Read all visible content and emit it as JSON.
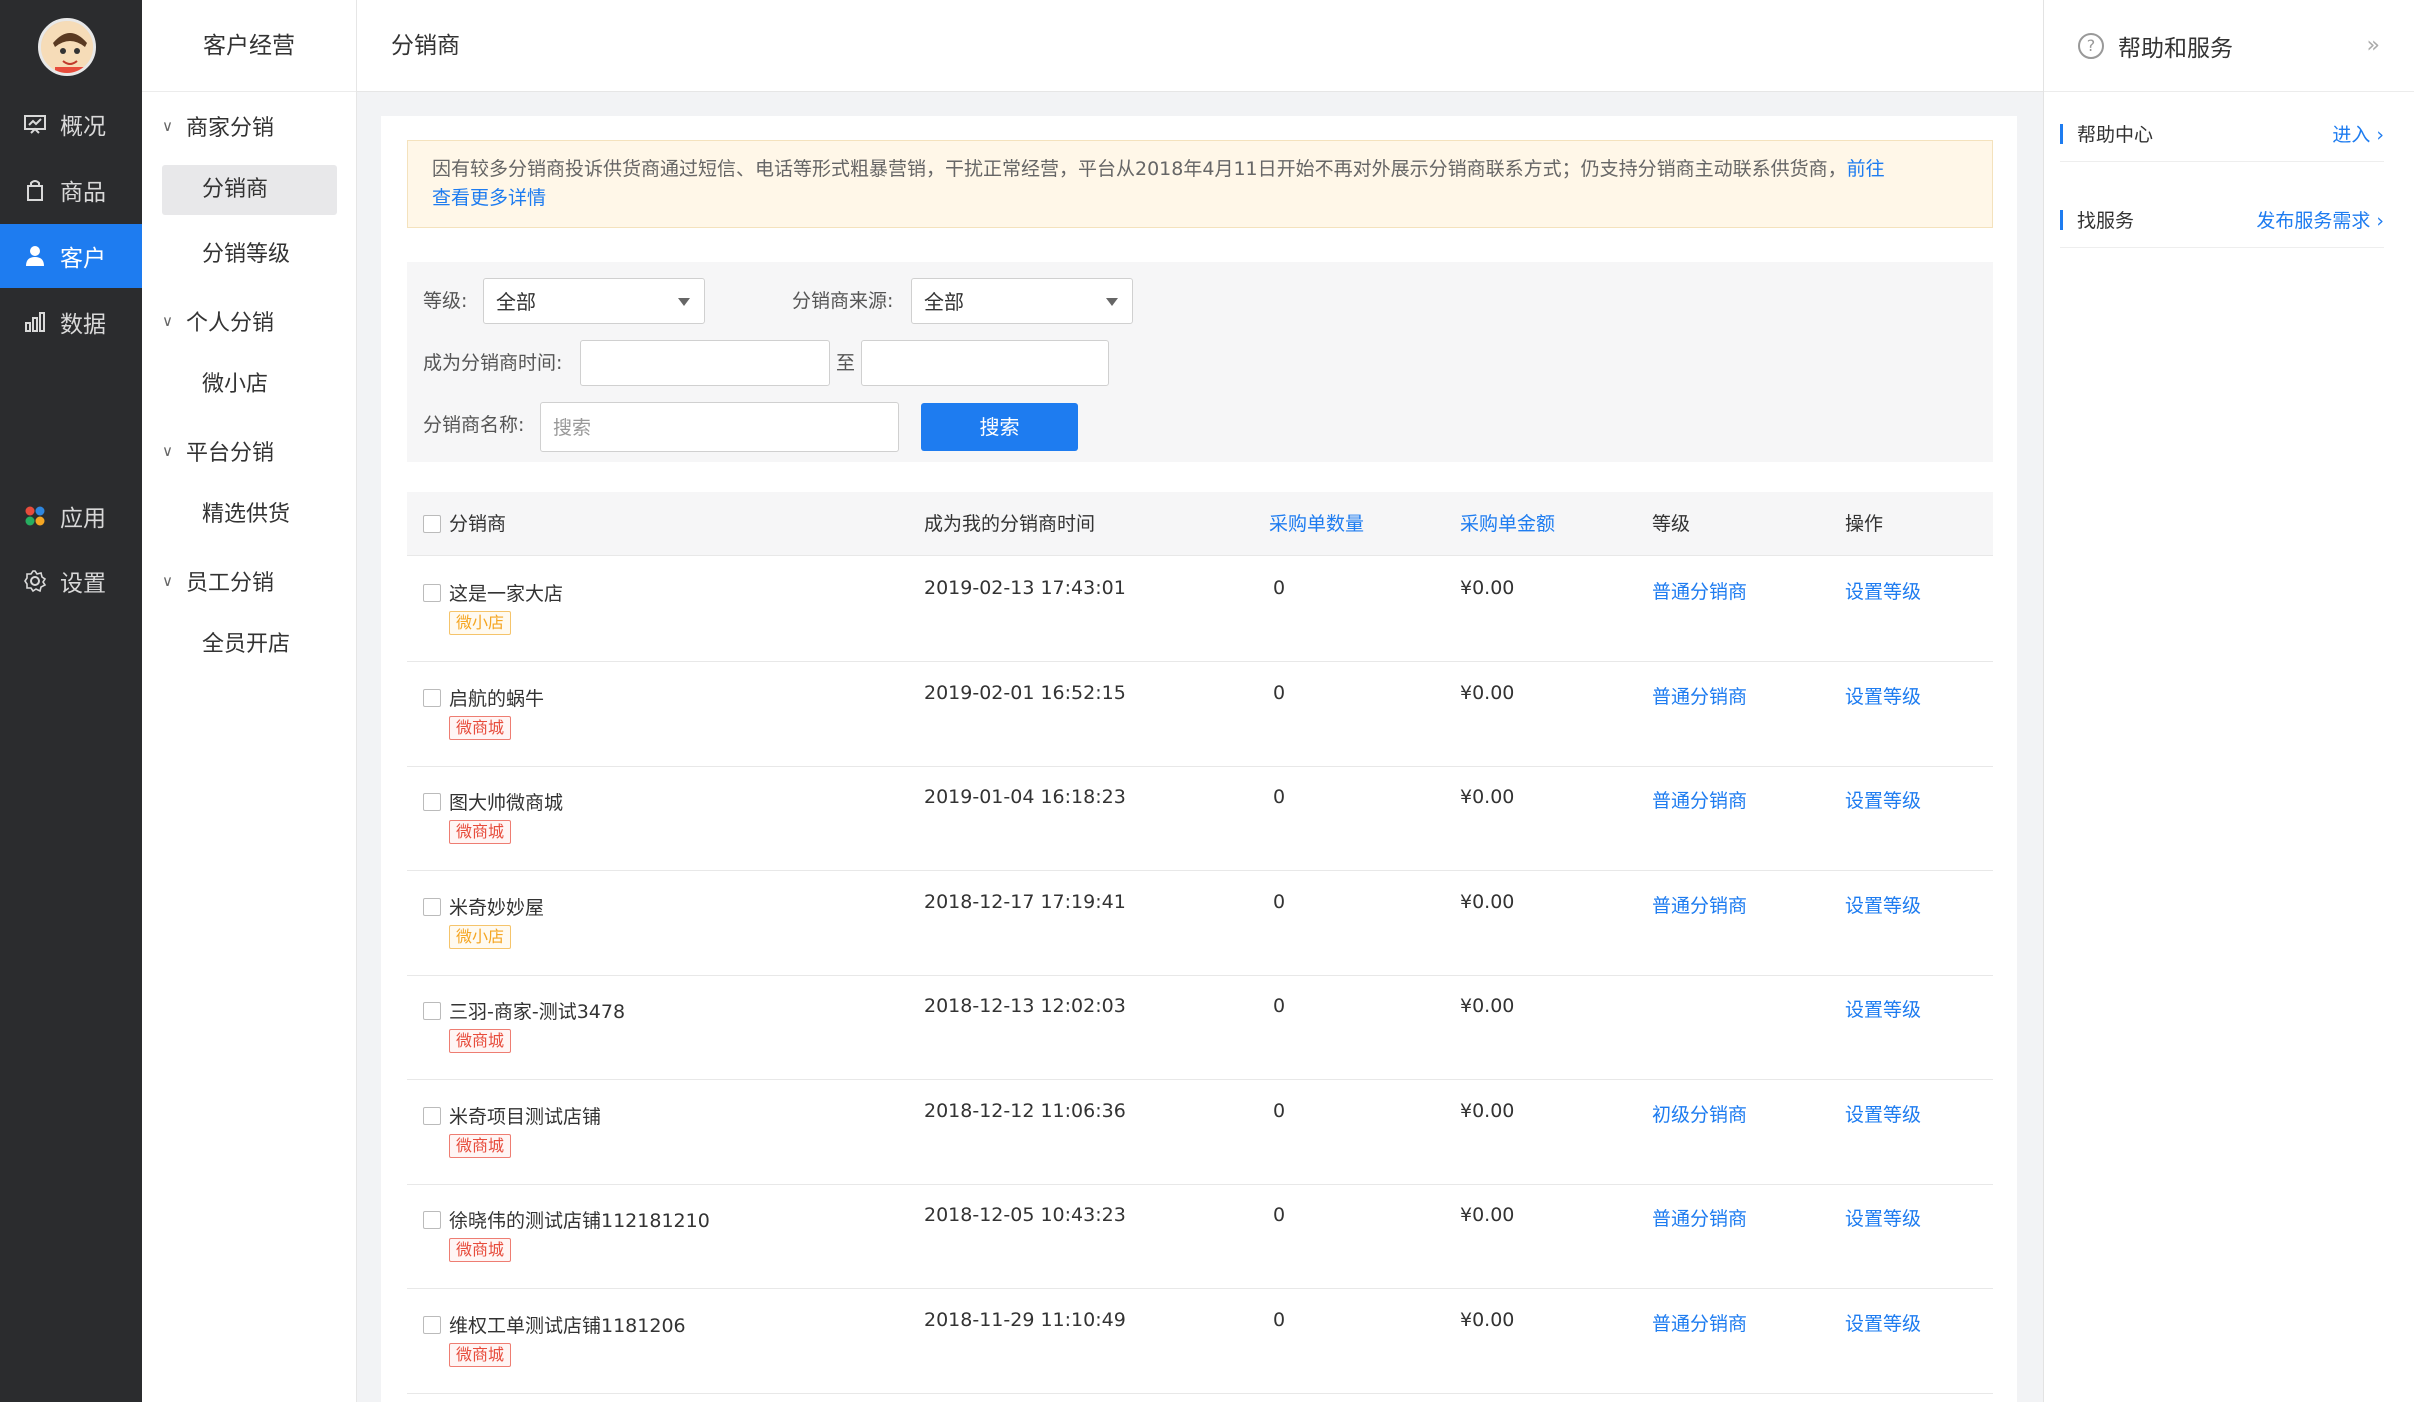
{
  "nav": {
    "items": [
      {
        "label": "概况",
        "icon": "dashboard-icon"
      },
      {
        "label": "商品",
        "icon": "bag-icon"
      },
      {
        "label": "客户",
        "icon": "user-icon"
      },
      {
        "label": "数据",
        "icon": "bar-chart-icon"
      },
      {
        "label": "应用",
        "icon": "apps-icon"
      },
      {
        "label": "设置",
        "icon": "gear-icon"
      }
    ],
    "active": "客户"
  },
  "subnav": {
    "title": "客户经营",
    "groups": [
      {
        "label": "商家分销",
        "items": [
          "分销商",
          "分销等级"
        ]
      },
      {
        "label": "个人分销",
        "items": [
          "微小店"
        ]
      },
      {
        "label": "平台分销",
        "items": [
          "精选供货"
        ]
      },
      {
        "label": "员工分销",
        "items": [
          "全员开店"
        ]
      }
    ],
    "active": "分销商"
  },
  "header": {
    "title": "分销商"
  },
  "help": {
    "title": "帮助和服务",
    "rows": [
      {
        "label": "帮助中心",
        "link": "进入"
      },
      {
        "label": "找服务",
        "link": "发布服务需求"
      }
    ]
  },
  "notice": {
    "text": "因有较多分销商投诉供货商通过短信、电话等形式粗暴营销，干扰正常经营，平台从2018年4月11日开始不再对外展示分销商联系方式；仍支持分销商主动联系供货商，",
    "link1": "前往",
    "link2": "查看更多详情"
  },
  "filter": {
    "level_label": "等级:",
    "level_value": "全部",
    "source_label": "分销商来源:",
    "source_value": "全部",
    "time_label": "成为分销商时间:",
    "time_sep": "至",
    "name_label": "分销商名称:",
    "name_placeholder": "搜索",
    "search_btn": "搜索"
  },
  "table": {
    "headers": {
      "name": "分销商",
      "time": "成为我的分销商时间",
      "count": "采购单数量",
      "amount": "采购单金额",
      "level": "等级",
      "action": "操作"
    },
    "rows": [
      {
        "name": "这是一家大店",
        "tag": "微小店",
        "tag_type": "orange",
        "time": "2019-02-13 17:43:01",
        "count": "0",
        "amount": "¥0.00",
        "level": "普通分销商",
        "action": "设置等级"
      },
      {
        "name": "启航的蜗牛",
        "tag": "微商城",
        "tag_type": "red",
        "time": "2019-02-01 16:52:15",
        "count": "0",
        "amount": "¥0.00",
        "level": "普通分销商",
        "action": "设置等级"
      },
      {
        "name": "图大帅微商城",
        "tag": "微商城",
        "tag_type": "red",
        "time": "2019-01-04 16:18:23",
        "count": "0",
        "amount": "¥0.00",
        "level": "普通分销商",
        "action": "设置等级"
      },
      {
        "name": "米奇妙妙屋",
        "tag": "微小店",
        "tag_type": "orange",
        "time": "2018-12-17 17:19:41",
        "count": "0",
        "amount": "¥0.00",
        "level": "普通分销商",
        "action": "设置等级"
      },
      {
        "name": "三羽-商家-测试3478",
        "tag": "微商城",
        "tag_type": "red",
        "time": "2018-12-13 12:02:03",
        "count": "0",
        "amount": "¥0.00",
        "level": "",
        "action": "设置等级"
      },
      {
        "name": "米奇项目测试店铺",
        "tag": "微商城",
        "tag_type": "red",
        "time": "2018-12-12 11:06:36",
        "count": "0",
        "amount": "¥0.00",
        "level": "初级分销商",
        "action": "设置等级"
      },
      {
        "name": "徐晓伟的测试店铺112181210",
        "tag": "微商城",
        "tag_type": "red",
        "time": "2018-12-05 10:43:23",
        "count": "0",
        "amount": "¥0.00",
        "level": "普通分销商",
        "action": "设置等级"
      },
      {
        "name": "维权工单测试店铺1181206",
        "tag": "微商城",
        "tag_type": "red",
        "time": "2018-11-29 11:10:49",
        "count": "0",
        "amount": "¥0.00",
        "level": "普通分销商",
        "action": "设置等级"
      }
    ]
  }
}
